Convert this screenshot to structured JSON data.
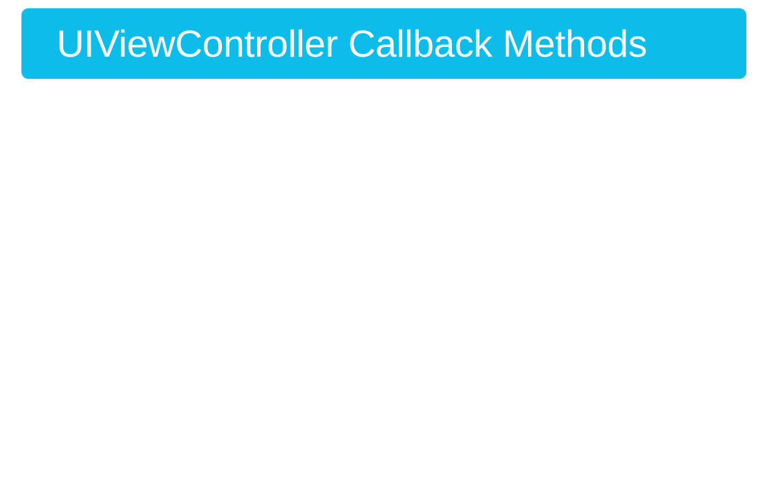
{
  "slide": {
    "title": "UIViewController Callback Methods",
    "colors": {
      "banner_background": "#0dbce8",
      "banner_text": "#ffffff",
      "page_background": "#ffffff"
    }
  }
}
